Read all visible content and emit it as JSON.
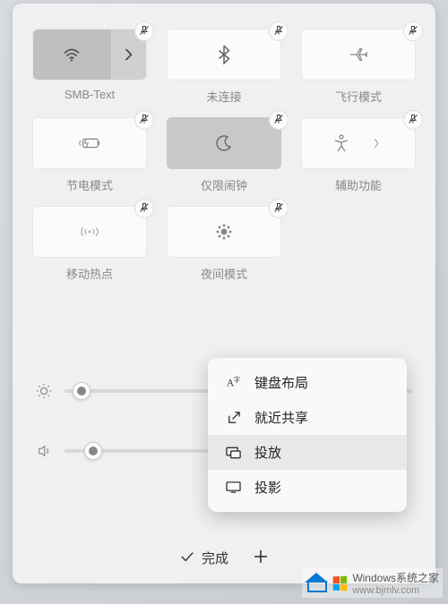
{
  "tiles": [
    {
      "id": "wifi",
      "label": "SMB-Text",
      "icon": "wifi",
      "split": true,
      "active": true,
      "pin": true
    },
    {
      "id": "bluetooth",
      "label": "未连接",
      "icon": "bluetooth",
      "active": false,
      "pin": true
    },
    {
      "id": "airplane",
      "label": "飞行模式",
      "icon": "airplane",
      "active": false,
      "pin": true
    },
    {
      "id": "battery",
      "label": "节电模式",
      "icon": "battery",
      "active": false,
      "pin": true
    },
    {
      "id": "focus",
      "label": "仅限闹钟",
      "icon": "moon",
      "active": true,
      "pin": true
    },
    {
      "id": "accessibility",
      "label": "辅助功能",
      "icon": "accessibility",
      "active": false,
      "pin": true,
      "chevron": true
    },
    {
      "id": "hotspot",
      "label": "移动热点",
      "icon": "hotspot",
      "active": false,
      "pin": true
    },
    {
      "id": "nightlight",
      "label": "夜间模式",
      "icon": "nightlight",
      "active": false,
      "pin": true
    }
  ],
  "sliders": {
    "brightness": {
      "value": 5
    },
    "volume": {
      "value": 9
    }
  },
  "popup": {
    "items": [
      {
        "id": "keyboard",
        "label": "键盘布局",
        "icon": "keyboard"
      },
      {
        "id": "nearby",
        "label": "就近共享",
        "icon": "share"
      },
      {
        "id": "cast",
        "label": "投放",
        "icon": "cast",
        "selected": true
      },
      {
        "id": "project",
        "label": "投影",
        "icon": "project"
      }
    ]
  },
  "footer": {
    "done_label": "完成",
    "add_label": ""
  },
  "watermark": {
    "text": "Windows系统之家",
    "url": "www.bjmlv.com"
  }
}
